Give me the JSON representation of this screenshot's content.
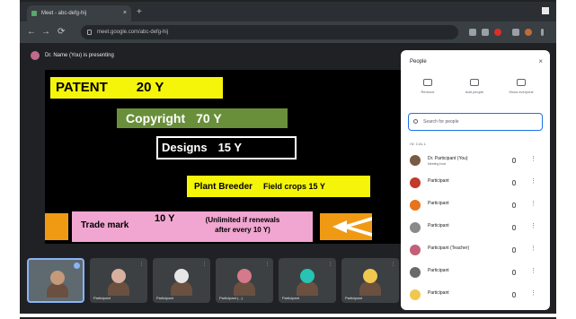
{
  "browser": {
    "tab_title": "Meet - abc-defg-hij",
    "tab_close": "×",
    "new_tab": "+",
    "url": "meet.google.com/abc-defg-hij",
    "back": "←",
    "forward": "→",
    "reload": "⟳"
  },
  "meet": {
    "presenting_label": "Dr. Name (You) is presenting"
  },
  "slide": {
    "patent_label": "PATENT",
    "patent_value": "20 Y",
    "copyright_label": "Copyright",
    "copyright_value": "70 Y",
    "designs_label": "Designs",
    "designs_value": "15 Y",
    "plant_label": "Plant Breeder",
    "plant_value": "Field crops 15  Y",
    "trade_label": "Trade mark",
    "trade_value": "10 Y",
    "trade_note": "(Unlimited  if renewals after every  10 Y)"
  },
  "tiles": [
    {
      "name": "",
      "face": "#c49a7a",
      "active": true
    },
    {
      "name": "Participant",
      "face": "#d8b0a0"
    },
    {
      "name": "Participant",
      "face": "#e6e6e6"
    },
    {
      "name": "Participant (...)",
      "face": "#d47a8a"
    },
    {
      "name": "Participant",
      "face": "#27c4b4"
    },
    {
      "name": "Participant",
      "face": "#f0c850"
    }
  ],
  "panel": {
    "title": "People",
    "close": "×",
    "actions": [
      "Remove",
      "Add people",
      "Show everyone"
    ],
    "search_placeholder": "Search for people",
    "in_call": "IN CALL",
    "people": [
      {
        "name": "Dr. Participant (You)",
        "sub": "Meeting host",
        "color": "#7a5a40"
      },
      {
        "name": "Participant",
        "sub": "",
        "color": "#c23a2a"
      },
      {
        "name": "Participant",
        "sub": "",
        "color": "#e8731a"
      },
      {
        "name": "Participant",
        "sub": "",
        "color": "#8a8a8a"
      },
      {
        "name": "Participant (Teacher)",
        "sub": "",
        "color": "#c2607a"
      },
      {
        "name": "Participant",
        "sub": "",
        "color": "#6a6a6a"
      },
      {
        "name": "Participant",
        "sub": "",
        "color": "#f0c850"
      }
    ]
  }
}
